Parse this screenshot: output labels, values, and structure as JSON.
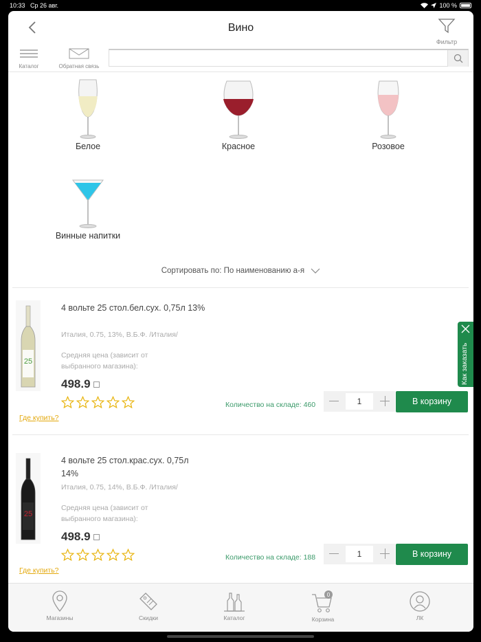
{
  "status_bar": {
    "time": "10:33",
    "date": "Ср 26 авг.",
    "battery": "100 %"
  },
  "header": {
    "title": "Вино",
    "filter_label": "Фильтр"
  },
  "toolbar": {
    "catalog_label": "Каталог",
    "feedback_label": "Обратная связь",
    "search_placeholder": ""
  },
  "categories": [
    {
      "name": "Белое",
      "icon": "white-wine-glass-icon"
    },
    {
      "name": "Красное",
      "icon": "red-wine-glass-icon"
    },
    {
      "name": "Розовое",
      "icon": "rose-wine-glass-icon"
    },
    {
      "name": "Винные напитки",
      "icon": "cocktail-glass-icon"
    }
  ],
  "sort": {
    "label": "Сортировать по: По наименованию а-я"
  },
  "products": [
    {
      "name": "4 вольте 25 стол.бел.сух. 0,75л 13%",
      "meta": "Италия, 0.75, 13%, В.Б.Ф. /Италия/",
      "avg_label": "Средняя цена (зависит от выбранного магазина):",
      "price": "498.9",
      "rating": 0,
      "where_label": "Где купить?",
      "stock": "Количество на складе: 460",
      "qty": "1",
      "cart_label": "В корзину",
      "bottle_color": "#d7d3a8"
    },
    {
      "name": "4 вольте 25 стол.крас.сух. 0,75л 14%",
      "meta": "Италия, 0.75, 14%, В.Б.Ф. /Италия/",
      "avg_label": "Средняя цена (зависит от выбранного магазина):",
      "price": "498.9",
      "rating": 0,
      "where_label": "Где купить?",
      "stock": "Количество на складе: 188",
      "qty": "1",
      "cart_label": "В корзину",
      "bottle_color": "#1b1b1b"
    }
  ],
  "side_tab": {
    "label": "Как заказать"
  },
  "tabbar": [
    {
      "label": "Магазины",
      "icon": "map-pin-icon"
    },
    {
      "label": "Скидки",
      "icon": "discount-tag-icon"
    },
    {
      "label": "Каталог",
      "icon": "bottles-icon"
    },
    {
      "label": "Корзина",
      "icon": "cart-icon",
      "badge": "0"
    },
    {
      "label": "ЛК",
      "icon": "user-icon"
    }
  ],
  "colors": {
    "accent": "#1f8a4c",
    "link": "#e3a80b",
    "stock_text": "#3b9a6a"
  }
}
